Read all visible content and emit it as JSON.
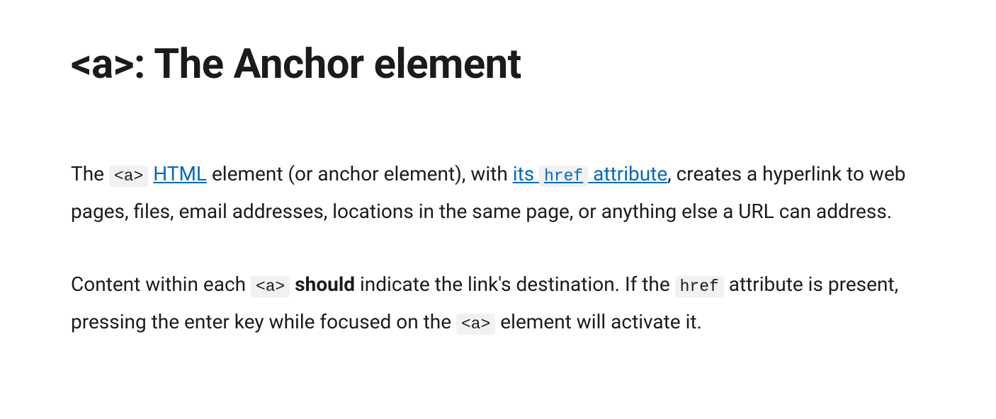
{
  "heading": "<a>: The Anchor element",
  "para1": {
    "t1": "The ",
    "code_a": "<a>",
    "space1": " ",
    "link_html": "HTML",
    "t2": " element (or anchor element), with ",
    "link_href_pre": "its ",
    "link_href_code": "href",
    "link_href_post": " attribute",
    "t3": ", creates a hyperlink to web pages, files, email addresses, locations in the same page, or anything else a URL can address."
  },
  "para2": {
    "t1": "Content within each ",
    "code_a1": "<a>",
    "space1": " ",
    "strong_should": "should",
    "t2": " indicate the link's destination. If the ",
    "code_href": "href",
    "t3": " attribute is present, pressing the enter key while focused on the ",
    "code_a2": "<a>",
    "t4": " element will activate it."
  }
}
